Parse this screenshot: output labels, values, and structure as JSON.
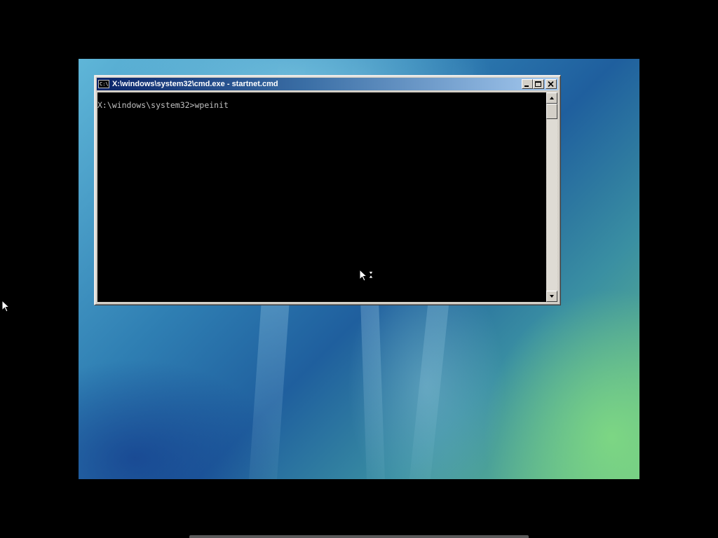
{
  "window": {
    "title": "X:\\windows\\system32\\cmd.exe - startnet.cmd",
    "icon": "cmd-app-icon",
    "icon_label": "C:\\.",
    "buttons": {
      "minimize": "minimize-icon",
      "maximize": "maximize-icon",
      "close": "close-icon"
    }
  },
  "console": {
    "lines": [
      "X:\\windows\\system32>wpeinit"
    ]
  },
  "scrollbar": {
    "position": 0
  },
  "colors": {
    "title_active_start": "#0a246a",
    "title_active_end": "#a6caf0",
    "console_bg": "#000000",
    "console_text": "#c0c0c0",
    "window_face": "#d4d0c8"
  },
  "cursors": {
    "busy": "busy-pointer-icon",
    "arrow": "arrow-pointer-icon"
  }
}
